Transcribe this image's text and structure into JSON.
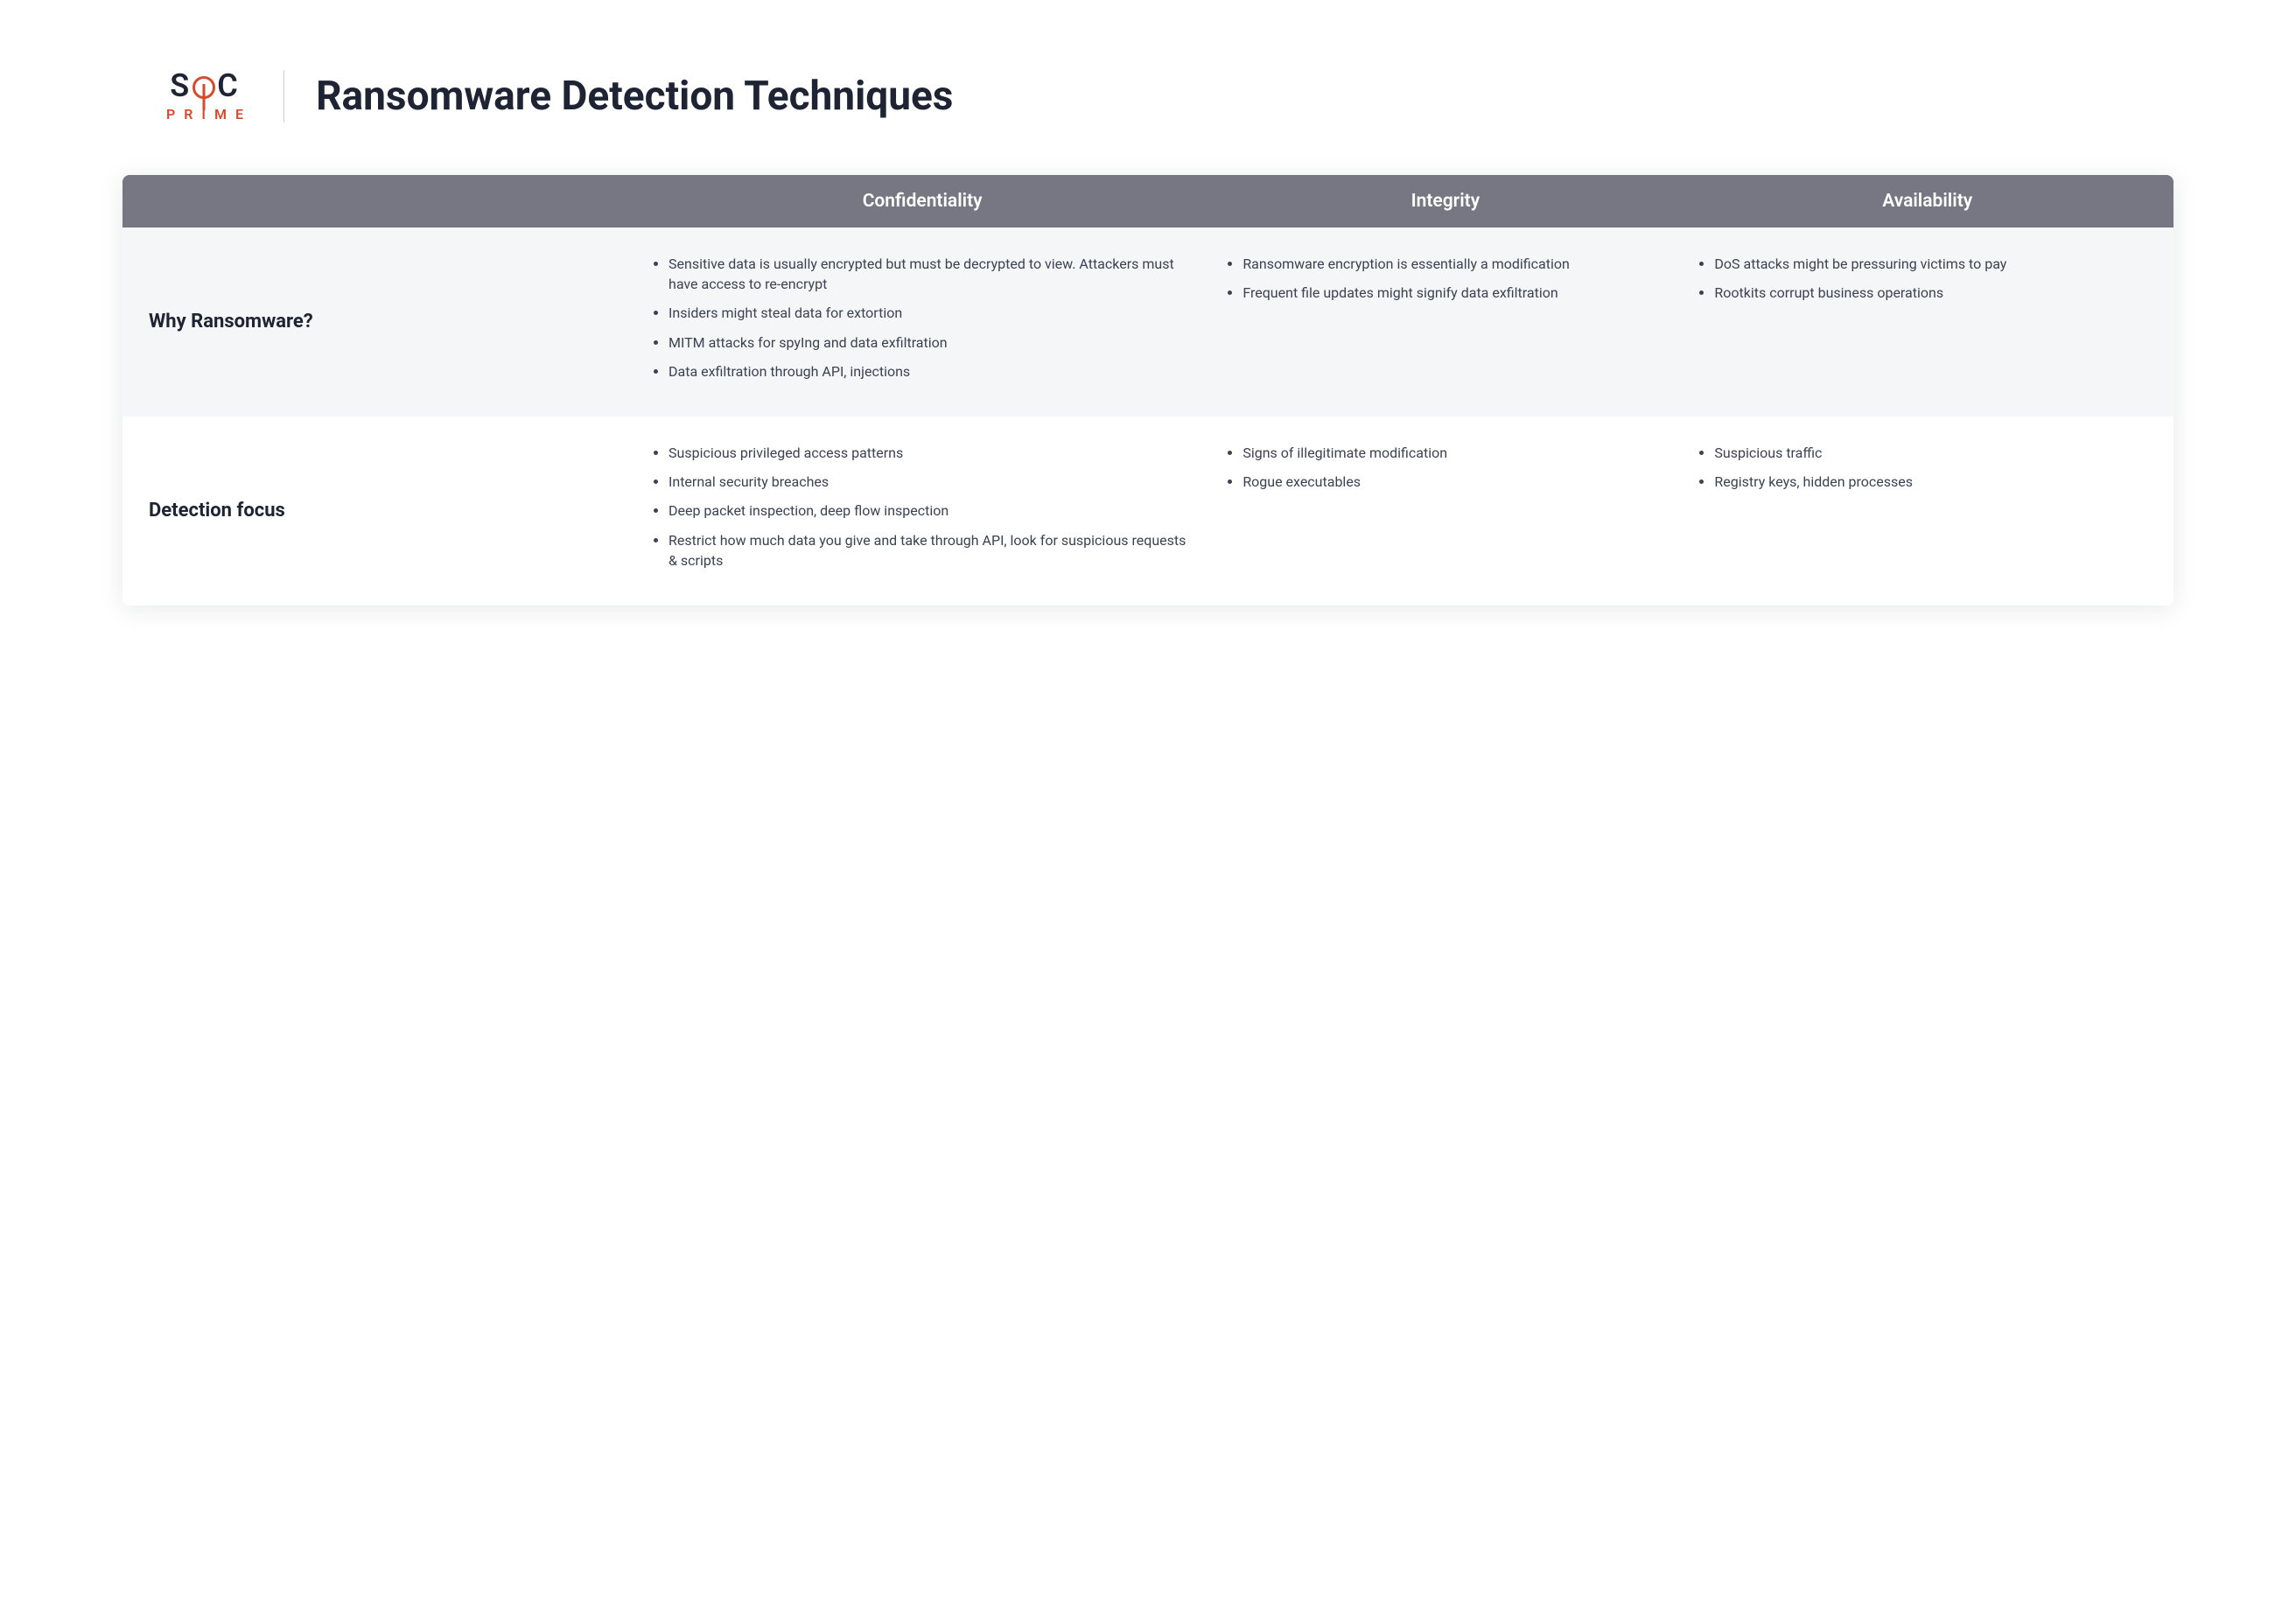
{
  "logo": {
    "top_left": "S",
    "top_right": "C",
    "bottom": "PRIME"
  },
  "title": "Ransomware Detection Techniques",
  "columns": [
    "",
    "Confidentiality",
    "Integrity",
    "Availability"
  ],
  "rows": [
    {
      "label": "Why Ransomware?",
      "cells": [
        [
          "Sensitive data is usually encrypted but must be decrypted to view. Attackers must have access to re-encrypt",
          "Insiders might steal data for extortion",
          "MITM attacks for spyIng and data exfiltration",
          "Data exfiltration through API, injections"
        ],
        [
          "Ransomware encryption is essentially a modification",
          "Frequent file updates might signify data exfiltration"
        ],
        [
          "DoS attacks might be pressuring victims to pay",
          "Rootkits corrupt business operations"
        ]
      ]
    },
    {
      "label": "Detection focus",
      "cells": [
        [
          "Suspicious privileged access patterns",
          "Internal security breaches",
          "Deep packet inspection, deep flow inspection",
          "Restrict how much data you give and take through API, look for suspicious requests & scripts"
        ],
        [
          "Signs of illegitimate modification",
          "Rogue executables"
        ],
        [
          "Suspicious traffic",
          "Registry keys, hidden processes"
        ]
      ]
    }
  ]
}
